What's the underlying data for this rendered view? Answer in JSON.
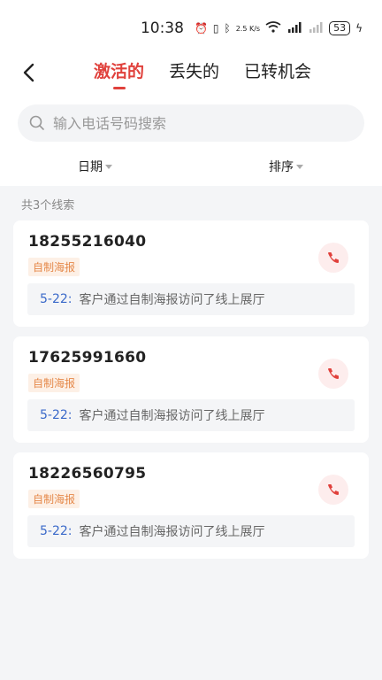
{
  "status_bar": {
    "time": "10:38",
    "network_speed": "2.5 K/s",
    "battery": "53"
  },
  "header": {
    "tabs": [
      {
        "label": "激活的",
        "active": true
      },
      {
        "label": "丢失的",
        "active": false
      },
      {
        "label": "已转机会",
        "active": false
      }
    ]
  },
  "search": {
    "placeholder": "输入电话号码搜索"
  },
  "filters": {
    "date_label": "日期",
    "sort_label": "排序"
  },
  "list": {
    "count_text": "共3个线索",
    "items": [
      {
        "phone": "18255216040",
        "tag": "自制海报",
        "date": "5-22:",
        "desc": "客户通过自制海报访问了线上展厅"
      },
      {
        "phone": "17625991660",
        "tag": "自制海报",
        "date": "5-22:",
        "desc": "客户通过自制海报访问了线上展厅"
      },
      {
        "phone": "18226560795",
        "tag": "自制海报",
        "date": "5-22:",
        "desc": "客户通过自制海报访问了线上展厅"
      }
    ]
  },
  "colors": {
    "accent": "#e0413c",
    "tag_bg": "#fdf0e6",
    "tag_text": "#e5894a",
    "date_blue": "#3a69c9"
  }
}
